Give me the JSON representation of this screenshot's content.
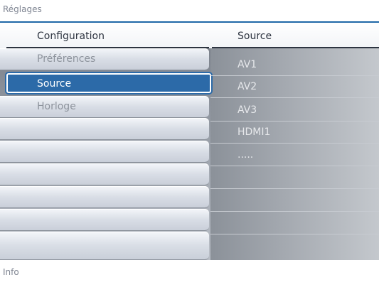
{
  "title": "Réglages",
  "header": {
    "left": "Configuration",
    "right": "Source"
  },
  "left_menu": {
    "items": [
      {
        "label": "Préférences",
        "selected": false
      },
      {
        "label": "Source",
        "selected": true
      },
      {
        "label": "Horloge",
        "selected": false
      },
      {
        "label": "",
        "selected": false
      },
      {
        "label": "",
        "selected": false
      },
      {
        "label": "",
        "selected": false
      },
      {
        "label": "",
        "selected": false
      },
      {
        "label": "",
        "selected": false
      },
      {
        "label": "",
        "selected": false
      }
    ]
  },
  "right_menu": {
    "items": [
      {
        "label": "AV1"
      },
      {
        "label": "AV2"
      },
      {
        "label": "AV3"
      },
      {
        "label": "HDMI1"
      },
      {
        "label": "....."
      },
      {
        "label": ""
      },
      {
        "label": ""
      },
      {
        "label": ""
      },
      {
        "label": ""
      }
    ]
  },
  "info": "Info",
  "colors": {
    "accent": "#2c6aa8",
    "title_line": "#1f67a7"
  }
}
